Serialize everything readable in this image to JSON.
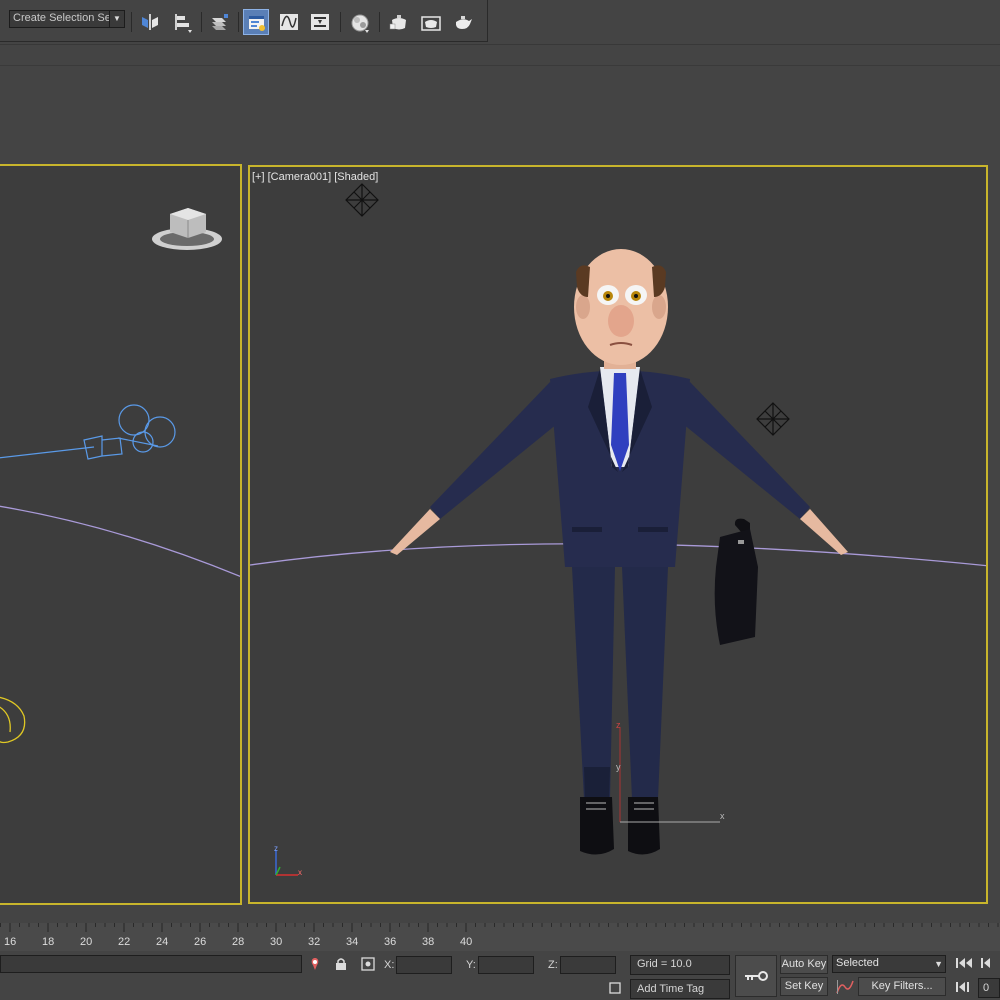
{
  "toolbar": {
    "selection_set_value": "Create Selection Se",
    "buttons": [
      {
        "name": "mirror-icon"
      },
      {
        "name": "align-icon"
      },
      {
        "name": "layer-manager-icon"
      },
      {
        "name": "scene-explorer-icon"
      },
      {
        "name": "curve-editor-icon"
      },
      {
        "name": "schematic-view-icon"
      },
      {
        "name": "material-editor-icon"
      },
      {
        "name": "render-setup-icon"
      },
      {
        "name": "rendered-frame-window-icon"
      },
      {
        "name": "render-production-icon"
      }
    ],
    "active_button": "scene-explorer-icon"
  },
  "viewports": {
    "main_label": "[+] [Camera001] [Shaded]",
    "border_color": "#c8b52c",
    "background": "#3d3d3d"
  },
  "timeline": {
    "ticks": [
      "16",
      "18",
      "20",
      "22",
      "24",
      "26",
      "28",
      "30",
      "32",
      "34",
      "36",
      "38",
      "40"
    ]
  },
  "status_bar": {
    "x_label": "X:",
    "y_label": "Y:",
    "z_label": "Z:",
    "x_value": "",
    "y_value": "",
    "z_value": "",
    "grid_text": "Grid = 10.0",
    "add_time_tag": "Add Time Tag",
    "auto_key": "Auto Key",
    "set_key": "Set Key",
    "selected_dropdown": "Selected",
    "key_filters": "Key Filters...",
    "frame_value": "0"
  },
  "colors": {
    "ui_background": "#444444",
    "selection_highlight": "#5a7fb6",
    "viewport_border": "#c8b52c",
    "suit": "#1f2540",
    "tie": "#2f3fbf",
    "curve": "#a99ad8",
    "camera_wire": "#5a9ae8",
    "light_wire": "#e0c824"
  }
}
